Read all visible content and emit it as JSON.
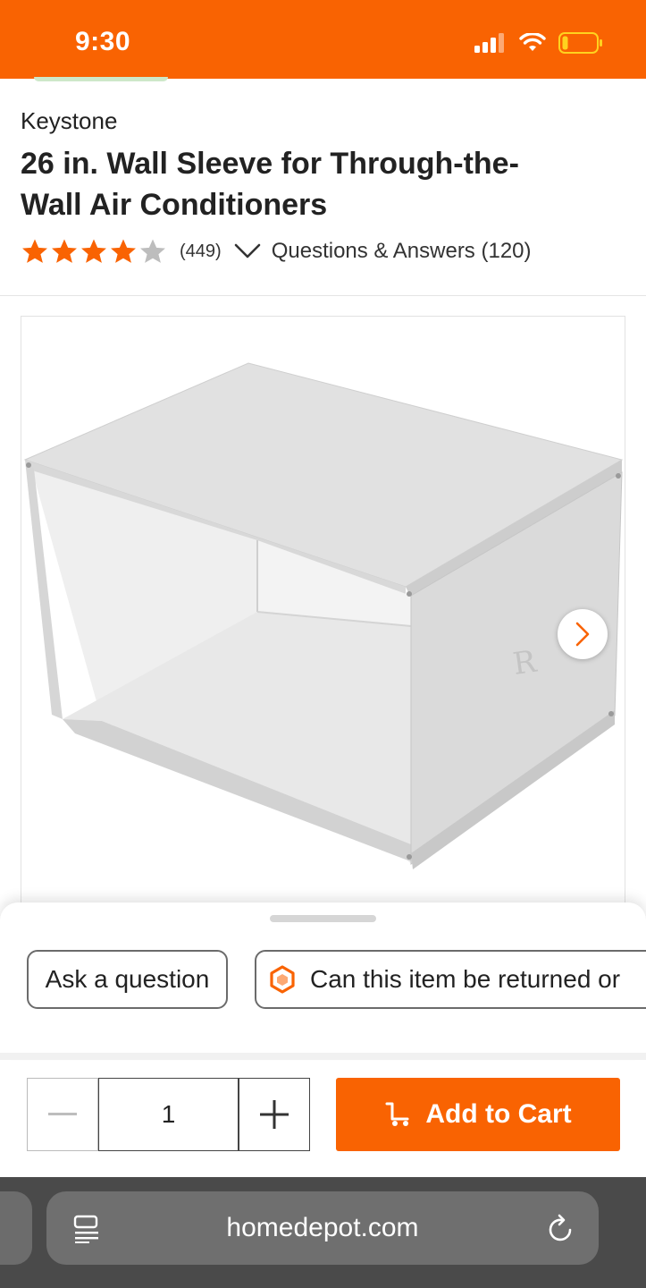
{
  "status_bar": {
    "time": "9:30",
    "accent": "#f96302"
  },
  "product": {
    "brand": "Keystone",
    "title": "26 in. Wall Sleeve for Through-the-Wall Air Conditioners",
    "rating": 4,
    "rating_max": 5,
    "review_count": "(449)",
    "qa_link": "Questions & Answers (120)",
    "image_alt": "Keystone wall sleeve product image",
    "next_image_icon": "chevron-right-icon"
  },
  "sheet": {
    "chips": [
      {
        "label": "Ask a question"
      },
      {
        "label": "Can this item be returned or",
        "icon": "hexagon-icon"
      }
    ]
  },
  "purchase": {
    "quantity": "1",
    "add_to_cart": "Add to Cart",
    "cart_icon": "cart-icon"
  },
  "browser": {
    "url": "homedepot.com"
  }
}
